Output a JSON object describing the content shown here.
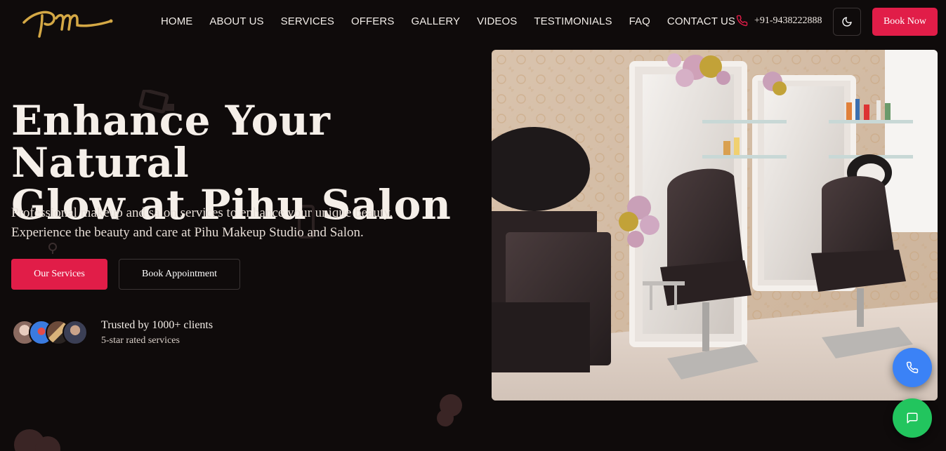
{
  "brand": {
    "logo_text": "pm",
    "logo_color": "#d4a845"
  },
  "nav": {
    "items": [
      "HOME",
      "ABOUT US",
      "SERVICES",
      "OFFERS",
      "GALLERY",
      "VIDEOS",
      "TESTIMONIALS",
      "FAQ",
      "CONTACT US"
    ]
  },
  "header": {
    "phone": "+91-9438222888",
    "phone_icon": "phone-icon",
    "theme_icon": "moon-icon",
    "book_now": "Book Now"
  },
  "hero": {
    "title_line1": "Enhance Your Natural",
    "title_line2": "Glow at Pihu Salon",
    "subtitle_line1": "Professional makeup and salon services to enhance your unique beauty.",
    "subtitle_line2": "Experience the beauty and care at Pihu Makeup Studio and Salon.",
    "primary_cta": "Our Services",
    "secondary_cta": "Book Appointment",
    "trust_main": "Trusted by 1000+ clients",
    "trust_sub": "5-star rated services",
    "image_alt": "salon-interior-photo"
  },
  "fabs": {
    "call_icon": "phone-icon",
    "chat_icon": "chat-icon"
  },
  "colors": {
    "accent": "#e11d48",
    "background": "#0f0b0b",
    "call_fab": "#3b82f6",
    "chat_fab": "#22c55e"
  }
}
